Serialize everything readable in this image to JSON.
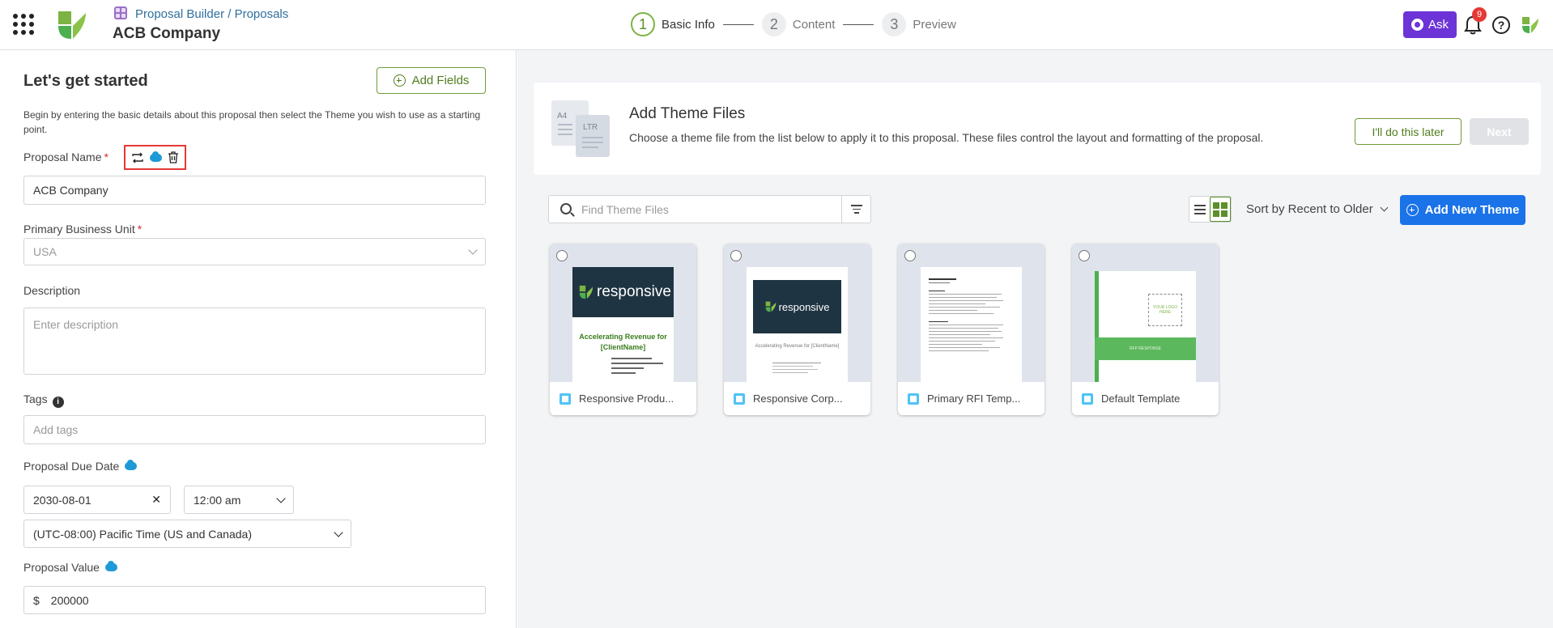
{
  "header": {
    "breadcrumb": "Proposal Builder / Proposals",
    "title": "ACB Company",
    "steps": [
      {
        "number": "1",
        "label": "Basic Info",
        "state": "active"
      },
      {
        "number": "2",
        "label": "Content",
        "state": "inactive"
      },
      {
        "number": "3",
        "label": "Preview",
        "state": "inactive"
      }
    ],
    "ask_label": "Ask",
    "notification_count": "9",
    "help_glyph": "?"
  },
  "left": {
    "heading": "Let's get started",
    "add_fields_label": "Add Fields",
    "intro": "Begin by entering the basic details about this proposal then select the Theme you wish to use as a starting point.",
    "proposal_name_label": "Proposal Name",
    "proposal_name_value": "ACB Company",
    "business_unit_label": "Primary Business Unit",
    "business_unit_value": "USA",
    "description_label": "Description",
    "description_placeholder": "Enter description",
    "tags_label": "Tags",
    "tags_placeholder": "Add tags",
    "due_date_label": "Proposal Due Date",
    "due_date_value": "2030-08-01",
    "due_time_value": "12:00 am",
    "timezone_value": "(UTC-08:00) Pacific Time (US and Canada)",
    "value_label": "Proposal Value",
    "currency_symbol": "$",
    "value_value": "200000",
    "required_mark": "*",
    "clear_glyph": "✕",
    "info_glyph": "i"
  },
  "right": {
    "theme_title": "Add Theme Files",
    "theme_desc": "Choose a theme file from the list below to apply it to this proposal. These files control the layout and formatting of the proposal.",
    "doc_a4": "A4",
    "doc_ltr": "LTR",
    "later_label": "I'll do this later",
    "next_label": "Next",
    "search_placeholder": "Find Theme Files",
    "sort_label": "Sort by Recent to Older",
    "add_theme_label": "Add New Theme",
    "tiles": [
      {
        "name": "Responsive Produ...",
        "brand": "responsive",
        "heading": "Accelerating Revenue for [ClientName]"
      },
      {
        "name": "Responsive Corp...",
        "brand": "responsive",
        "heading": "Accelerating Revenue for [ClientName]"
      },
      {
        "name": "Primary RFI Temp..."
      },
      {
        "name": "Default Template",
        "logo_text": "YOUR LOGO HERE",
        "band_text": "RFP RESPONSE"
      }
    ]
  },
  "colors": {
    "accent_green": "#5a8f2a",
    "primary_blue": "#1a73e8",
    "ask_purple": "#6c34d6",
    "alert_red": "#e53935"
  }
}
